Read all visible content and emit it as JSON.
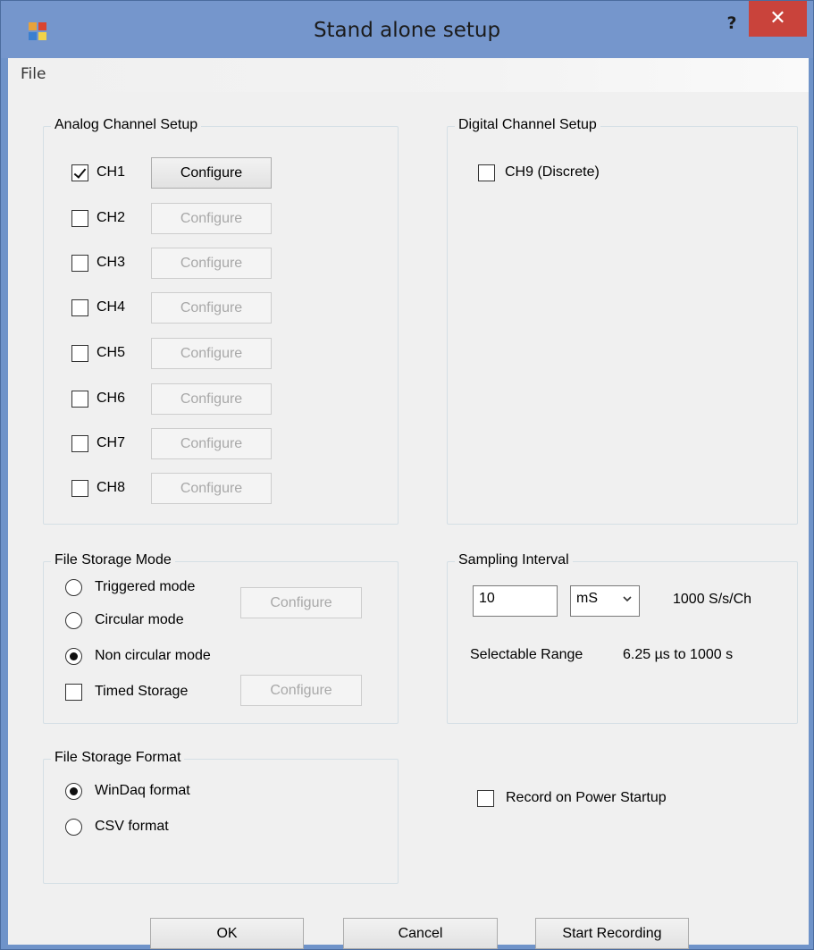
{
  "window": {
    "title": "Stand alone setup",
    "help": "?",
    "close": "✕"
  },
  "menu": {
    "file": "File"
  },
  "analog": {
    "title": "Analog Channel Setup",
    "configure_label": "Configure",
    "channels": [
      {
        "label": "CH1",
        "checked": true,
        "enabled": true
      },
      {
        "label": "CH2",
        "checked": false,
        "enabled": false
      },
      {
        "label": "CH3",
        "checked": false,
        "enabled": false
      },
      {
        "label": "CH4",
        "checked": false,
        "enabled": false
      },
      {
        "label": "CH5",
        "checked": false,
        "enabled": false
      },
      {
        "label": "CH6",
        "checked": false,
        "enabled": false
      },
      {
        "label": "CH7",
        "checked": false,
        "enabled": false
      },
      {
        "label": "CH8",
        "checked": false,
        "enabled": false
      }
    ]
  },
  "digital": {
    "title": "Digital Channel Setup",
    "ch9_label": "CH9 (Discrete)",
    "ch9_checked": false
  },
  "storage_mode": {
    "title": "File Storage Mode",
    "triggered": "Triggered mode",
    "circular": "Circular mode",
    "non_circular": "Non circular mode",
    "timed": "Timed Storage",
    "configure_label": "Configure",
    "selected": "non_circular"
  },
  "sampling": {
    "title": "Sampling Interval",
    "value": "10",
    "unit": "mS",
    "rate": "1000  S/s/Ch",
    "range_label": "Selectable Range",
    "range_value": "6.25 µs to 1000 s"
  },
  "storage_format": {
    "title": "File Storage Format",
    "windaq": "WinDaq format",
    "csv": "CSV format",
    "selected": "windaq"
  },
  "power": {
    "label": "Record on Power Startup",
    "checked": false
  },
  "footer": {
    "ok": "OK",
    "cancel": "Cancel",
    "start": "Start Recording"
  }
}
